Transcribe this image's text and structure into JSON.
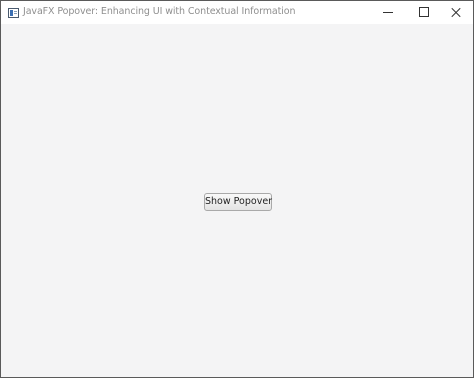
{
  "window": {
    "title": "JavaFX Popover: Enhancing UI with Contextual Information",
    "icon": "app-window-icon",
    "controls": [
      "minimize",
      "maximize",
      "close"
    ]
  },
  "content": {
    "show_popover_label": "Show Popover"
  },
  "colors": {
    "titlebar": "#ffffff",
    "background": "#f4f4f5",
    "title_text": "#8f8f8f",
    "border": "#5a5a5a"
  }
}
